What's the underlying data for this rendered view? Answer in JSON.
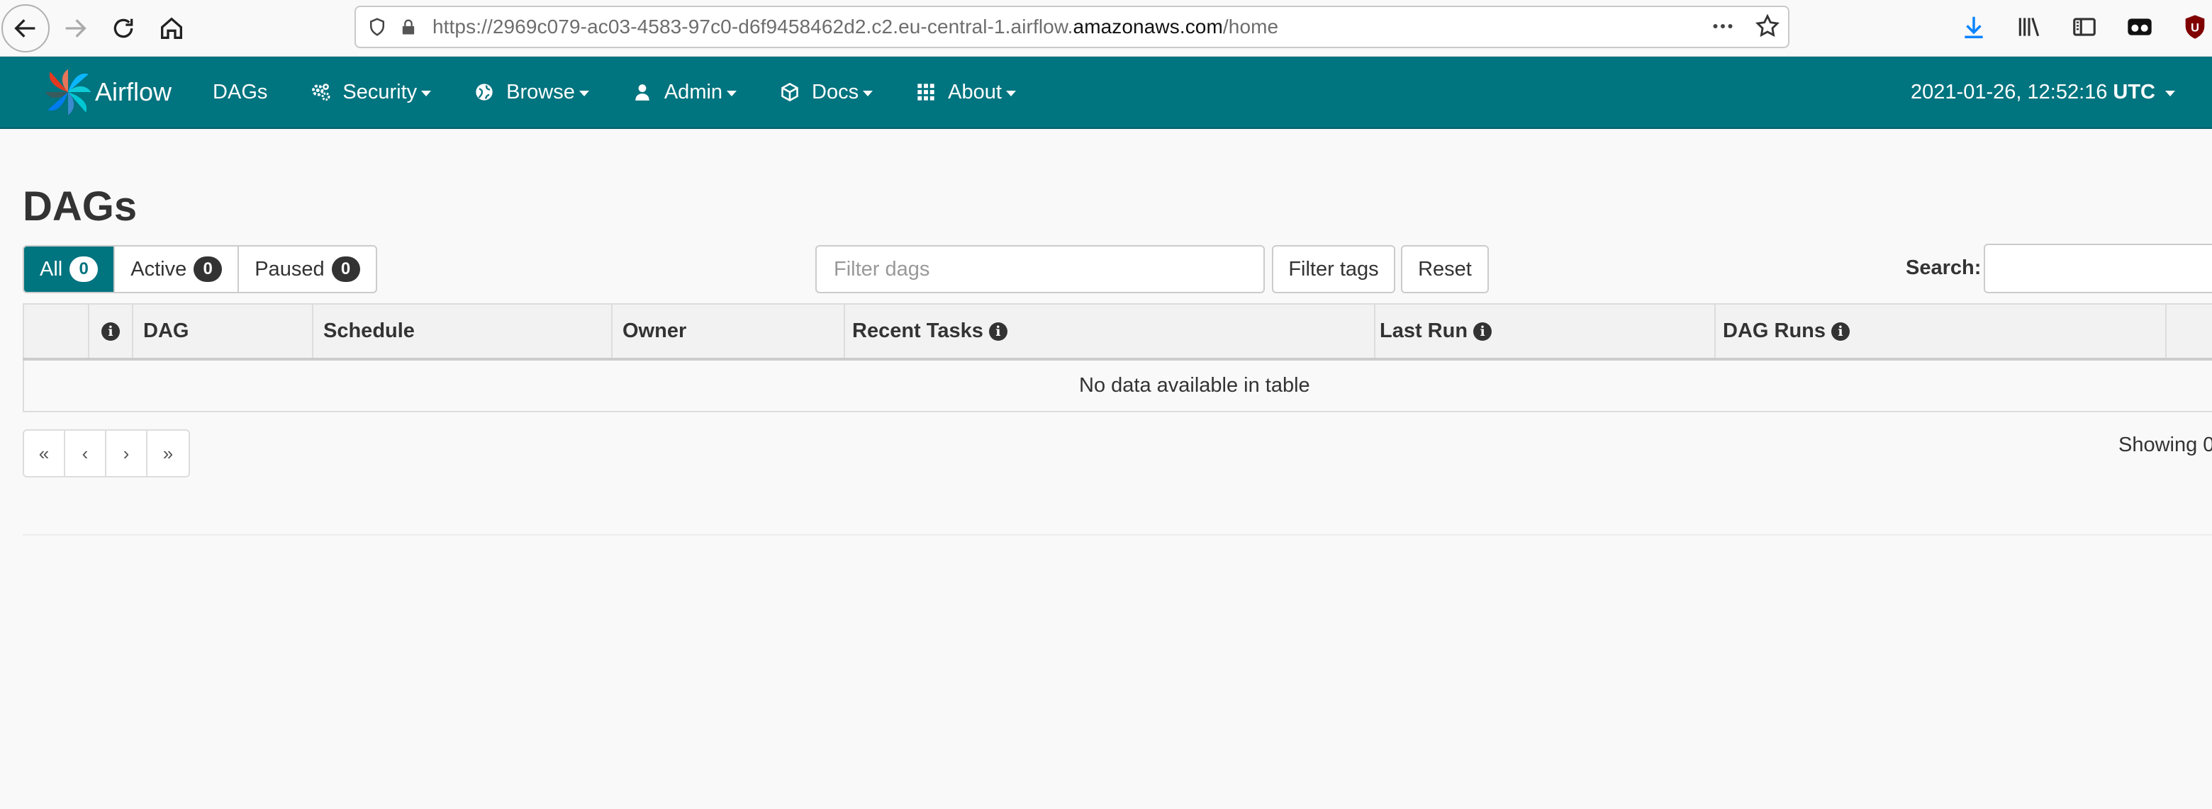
{
  "browser": {
    "url_prefix": "https://2969c079-ac03-4583-97c0-d6f9458462d2.c2.eu-central-1.airflow.",
    "url_host": "amazonaws.com",
    "url_path": "/home",
    "icons": [
      "back-icon",
      "forward-icon",
      "reload-icon",
      "home-icon",
      "shield-icon",
      "lock-icon",
      "more-icon",
      "star-icon",
      "download-icon",
      "library-icon",
      "sidebar-icon",
      "extension-icon",
      "ublock-icon"
    ]
  },
  "navbar": {
    "brand": "Airflow",
    "items": [
      {
        "label": "DAGs",
        "icon": ""
      },
      {
        "label": "Security",
        "icon": "gears-icon"
      },
      {
        "label": "Browse",
        "icon": "globe-icon"
      },
      {
        "label": "Admin",
        "icon": "user-icon"
      },
      {
        "label": "Docs",
        "icon": "cube-icon"
      },
      {
        "label": "About",
        "icon": "grid-icon"
      }
    ],
    "time": "2021-01-26, 12:52:16",
    "timezone": "UTC",
    "color": "#00747f"
  },
  "page": {
    "title": "DAGs",
    "tabs": [
      {
        "label": "All",
        "count": "0"
      },
      {
        "label": "Active",
        "count": "0"
      },
      {
        "label": "Paused",
        "count": "0"
      }
    ],
    "filter_placeholder": "Filter dags",
    "filter_tags_label": "Filter tags",
    "reset_label": "Reset",
    "search_label": "Search:"
  },
  "table": {
    "columns": [
      "",
      "",
      "DAG",
      "Schedule",
      "Owner",
      "Recent Tasks",
      "Last Run",
      "DAG Runs",
      ""
    ],
    "empty_message": "No data available in table"
  },
  "pagination": {
    "buttons": [
      "«",
      "‹",
      "›",
      "»"
    ],
    "showing": "Showing 0"
  }
}
